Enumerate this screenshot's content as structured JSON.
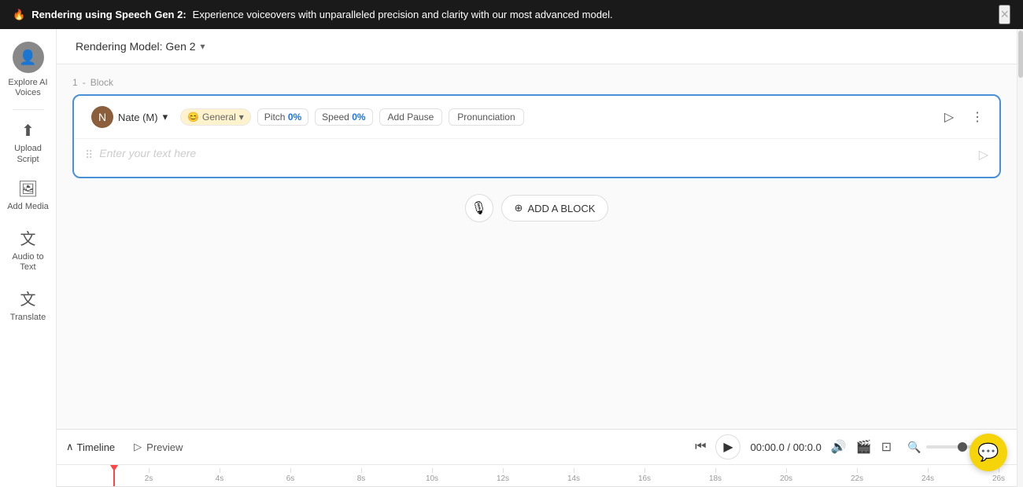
{
  "notif_bar": {
    "icon": "🔥",
    "bold_text": "Rendering using Speech Gen 2:",
    "description": " Experience voiceovers with unparalleled precision and clarity with our most advanced model.",
    "close_label": "×"
  },
  "sidebar": {
    "explore_label": "Explore AI Voices",
    "upload_label": "Upload Script",
    "media_label": "Add Media",
    "audio_to_text_label": "Audio to Text",
    "translate_label": "Translate"
  },
  "top_bar": {
    "rendering_model_label": "Rendering Model: Gen 2",
    "chevron": "▾"
  },
  "editor": {
    "block_number": "1",
    "block_label": "Block",
    "voice_name": "Nate (M)",
    "style_emoji": "😊",
    "style_label": "General",
    "pitch_label": "Pitch",
    "pitch_value": "0%",
    "speed_label": "Speed",
    "speed_value": "0%",
    "add_pause_label": "Add Pause",
    "pronunciation_label": "Pronunciation",
    "text_placeholder": "Enter your text here"
  },
  "add_block": {
    "mic_icon": "🎙",
    "add_label": "ADD A BLOCK",
    "add_icon": "⊕"
  },
  "timeline": {
    "toggle_label": "Timeline",
    "collapse_icon": "∧",
    "preview_icon": "▷",
    "preview_label": "Preview",
    "skip_back_icon": "⏮",
    "play_icon": "▶",
    "time_current": "00:00.0",
    "time_total": "00:0.0",
    "volume_icon": "🔊",
    "clapper_icon": "🎬",
    "caption_icon": "⊡",
    "zoom_in_icon": "🔍",
    "zoom_out_icon": "🔍",
    "ruler_marks": [
      "2s",
      "4s",
      "6s",
      "8s",
      "10s",
      "12s",
      "14s",
      "16s",
      "18s",
      "20s",
      "22s",
      "24s",
      "26s"
    ]
  },
  "chat": {
    "icon": "💬"
  }
}
